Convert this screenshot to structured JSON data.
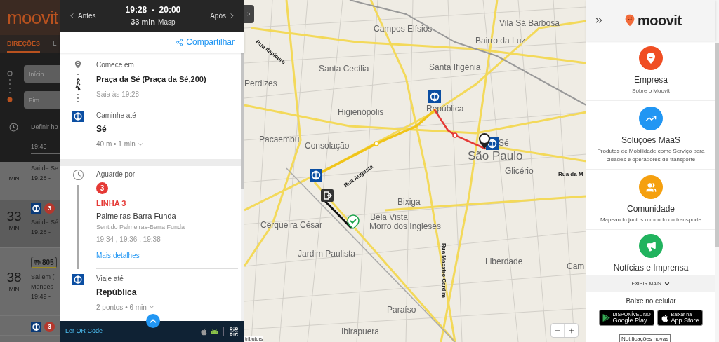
{
  "left_panel": {
    "logo": "moovit",
    "tabs": [
      {
        "label": "DIREÇÕES",
        "selected": true
      },
      {
        "label": "L",
        "selected": false
      }
    ],
    "from": {
      "placeholder": "Início"
    },
    "to": {
      "placeholder": "Fim"
    },
    "time_label": "Definir ho",
    "time_value": "19:45",
    "routes": [
      {
        "unit": "MIN",
        "lines": [
          "Sai de Se",
          "19:28 -"
        ],
        "selected": false
      },
      {
        "minutes": "33",
        "unit": "MIN",
        "badges": [
          {
            "kind": "metro"
          },
          {
            "kind": "line",
            "text": "3",
            "color": "#b4372d"
          }
        ],
        "lines": [
          "Sai de Sé",
          "19:28 -"
        ],
        "selected": true
      },
      {
        "minutes": "38",
        "unit": "MIN",
        "badges": [
          {
            "kind": "bus",
            "text": "805"
          }
        ],
        "lines": [
          "Sai em (",
          "Mendes",
          "19:49 -"
        ],
        "selected": false
      },
      {
        "badges": [
          {
            "kind": "metro"
          },
          {
            "kind": "line",
            "text": "3",
            "color": "#b4372d"
          }
        ],
        "selected": false
      }
    ]
  },
  "itinerary": {
    "header": {
      "prev": "Antes",
      "next": "Após",
      "time_range": "19:28  -  20:00",
      "duration": "33 min",
      "destination": "Masp"
    },
    "share": "Compartilhar",
    "steps": [
      {
        "kind": "start",
        "label": "Comece em",
        "title": "Praça da Sé (Praça da Sé,200)",
        "detail": "Saia às 19:28"
      },
      {
        "kind": "walk",
        "label": "Caminhe até",
        "title": "Sé",
        "detail": "40 m • 1 min"
      },
      {
        "kind": "wait",
        "label": "Aguarde por",
        "badge": "3",
        "color": "#e53935",
        "line_name": "LINHA 3",
        "route": "Palmeiras-Barra Funda",
        "direction": "Sentido Palmeiras-Barra Funda",
        "times": "19:34 , 19:36 , 19:38",
        "link": "Mais detalhes"
      },
      {
        "kind": "ride",
        "label": "Viaje até",
        "title": "República",
        "detail": "2 pontos • 6 min"
      }
    ],
    "footer": {
      "qr_link": "Ler QR Code"
    }
  },
  "map": {
    "labels": [
      {
        "text": "Campos Elísios",
        "kind": "area"
      },
      {
        "text": "Vila Sá Barbosa",
        "kind": "area"
      },
      {
        "text": "Bairro da Luz",
        "kind": "area"
      },
      {
        "text": "Rua Itapicuru",
        "kind": "street"
      },
      {
        "text": "Santa Cecília",
        "kind": "area"
      },
      {
        "text": "Santa Ifigênia",
        "kind": "area"
      },
      {
        "text": "Perdizes",
        "kind": "area"
      },
      {
        "text": "República",
        "kind": "area"
      },
      {
        "text": "Higienópolis",
        "kind": "area"
      },
      {
        "text": "Pacaembu",
        "kind": "area"
      },
      {
        "text": "Consolação",
        "kind": "area"
      },
      {
        "text": "Sé",
        "kind": "area"
      },
      {
        "text": "São Paulo",
        "kind": "city"
      },
      {
        "text": "Glicério",
        "kind": "area"
      },
      {
        "text": "Rua da M",
        "kind": "street"
      },
      {
        "text": "Rua Augusta",
        "kind": "street"
      },
      {
        "text": "Bixiga",
        "kind": "area"
      },
      {
        "text": "Cerqueira César",
        "kind": "area"
      },
      {
        "text": "Bela Vista",
        "kind": "area"
      },
      {
        "text": "Morro dos Ingleses",
        "kind": "area"
      },
      {
        "text": "Jardim Paulista",
        "kind": "area"
      },
      {
        "text": "Liberdade",
        "kind": "area"
      },
      {
        "text": "Cam",
        "kind": "area"
      },
      {
        "text": "Rua Maestro Cardim",
        "kind": "street"
      },
      {
        "text": "Paraíso",
        "kind": "area"
      },
      {
        "text": "Ibirapuera",
        "kind": "area"
      }
    ],
    "attribution": "tributors"
  },
  "right_panel": {
    "logo": "moovit",
    "cards": [
      {
        "kind": "company",
        "title": "Empresa",
        "subtitle": "Sobre o Moovit",
        "color": "#f04e23"
      },
      {
        "kind": "solutions",
        "title": "Soluções MaaS",
        "subtitle": "Produtos de Mobilidade como Serviço para cidades e operadores de transporte",
        "color": "#2196f3"
      },
      {
        "kind": "community",
        "title": "Comunidade",
        "subtitle": "Mapeando juntos o mundo do transporte",
        "color": "#f5a00f"
      },
      {
        "kind": "news",
        "title": "Notícias e Imprensa",
        "color": "#21b35e"
      }
    ],
    "show_more": "EXIBIR MAIS",
    "download": "Baixe no celular",
    "stores": [
      {
        "kind": "google",
        "small": "DISPONÍVEL NO",
        "name": "Google Play"
      },
      {
        "kind": "apple",
        "small": "Baixar na",
        "name": "App Store"
      }
    ],
    "tooltip": "Notificações novas"
  }
}
